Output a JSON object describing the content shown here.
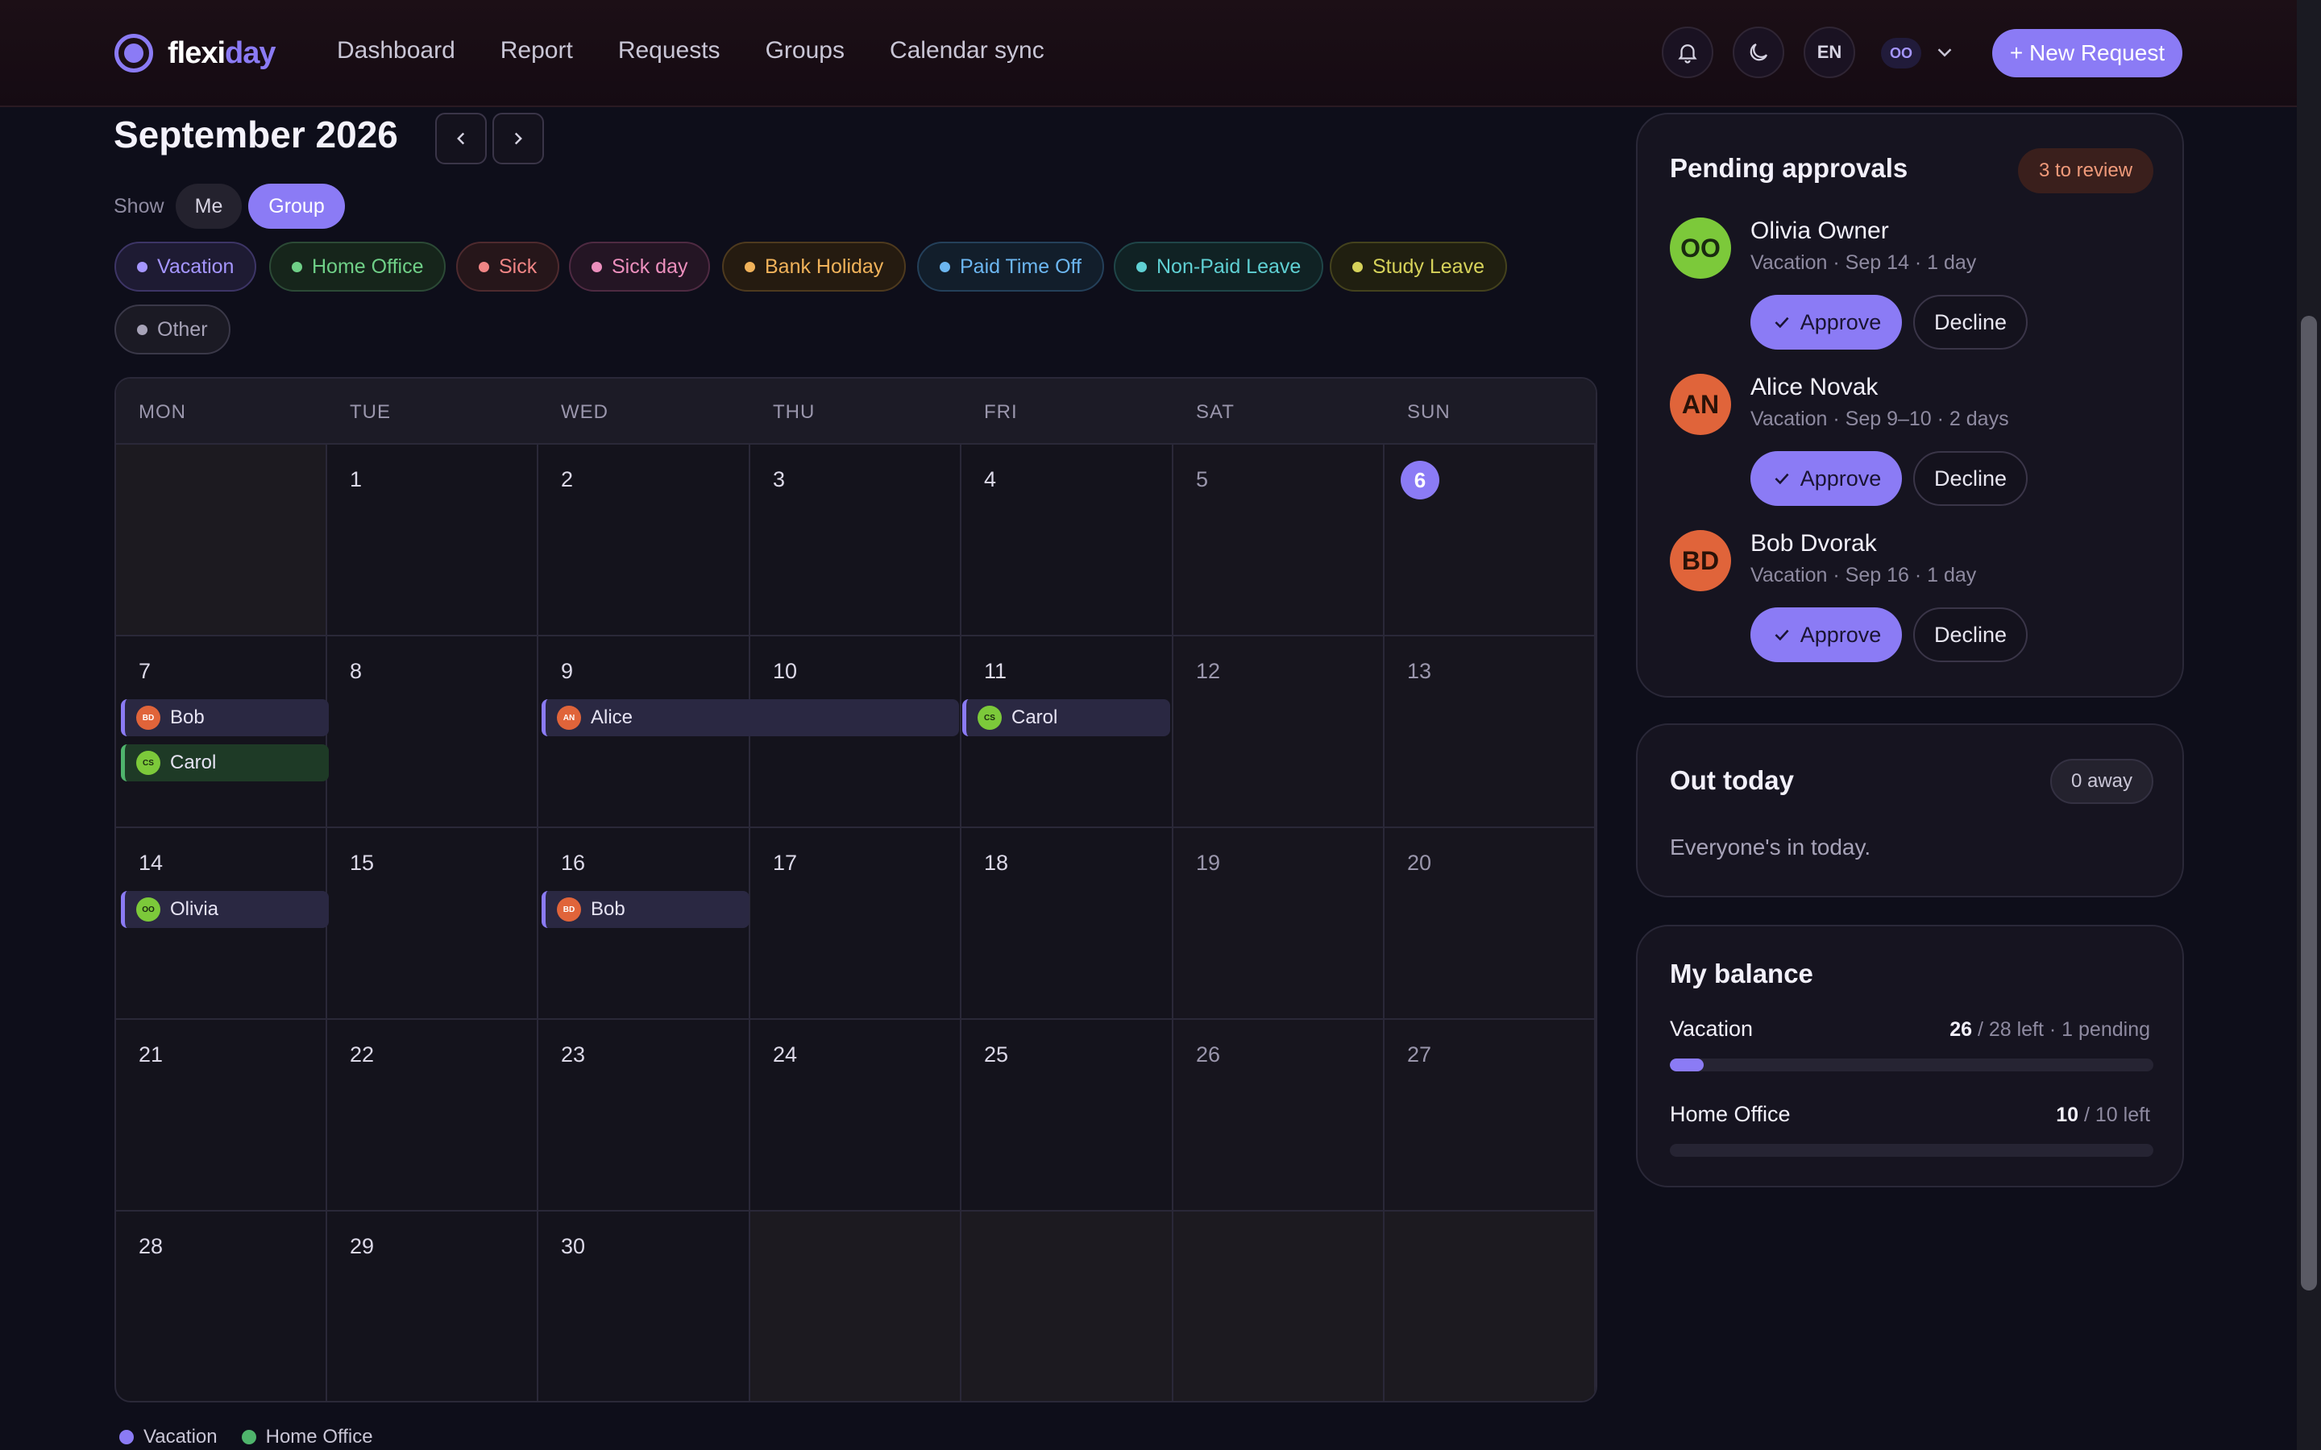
{
  "header": {
    "logo": {
      "part1": "flexi",
      "part2": "day"
    },
    "nav": [
      "Dashboard",
      "Report",
      "Requests",
      "Groups",
      "Calendar sync"
    ],
    "lang": "EN",
    "user_initials": "OO",
    "new_request": "+ New Request"
  },
  "calendar": {
    "title": "September 2026",
    "show_label": "Show",
    "toggle_me": "Me",
    "toggle_group": "Group",
    "filters": [
      {
        "label": "Vacation",
        "color": "#8b7bf5"
      },
      {
        "label": "Home Office",
        "color": "#4fb46c"
      },
      {
        "label": "Sick",
        "color": "#ef6b6b"
      },
      {
        "label": "Sick day",
        "color": "#e06fa8"
      },
      {
        "label": "Bank Holiday",
        "color": "#e9a23b"
      },
      {
        "label": "Paid Time Off",
        "color": "#4ea3e6"
      },
      {
        "label": "Non-Paid Leave",
        "color": "#3cc0c4"
      },
      {
        "label": "Study Leave",
        "color": "#c5c23a"
      },
      {
        "label": "Other",
        "color": "#9a96ac"
      }
    ],
    "weekdays": [
      "MON",
      "TUE",
      "WED",
      "THU",
      "FRI",
      "SAT",
      "SUN"
    ],
    "weeks": [
      [
        "",
        "1",
        "2",
        "3",
        "4",
        "5",
        "6"
      ],
      [
        "7",
        "8",
        "9",
        "10",
        "11",
        "12",
        "13"
      ],
      [
        "14",
        "15",
        "16",
        "17",
        "18",
        "19",
        "20"
      ],
      [
        "21",
        "22",
        "23",
        "24",
        "25",
        "26",
        "27"
      ],
      [
        "28",
        "29",
        "30",
        "",
        "",
        "",
        ""
      ]
    ],
    "today": "6",
    "events": [
      {
        "name": "Bob",
        "initials": "BD",
        "avatar": "#e0643a"
      },
      {
        "name": "Carol",
        "initials": "CS",
        "avatar": "#7cc93a"
      },
      {
        "name": "Alice",
        "initials": "AN",
        "avatar": "#e0643a"
      },
      {
        "name": "Carol",
        "initials": "CS",
        "avatar": "#7cc93a"
      },
      {
        "name": "Olivia",
        "initials": "OO",
        "avatar": "#7cc93a"
      },
      {
        "name": "Bob",
        "initials": "BD",
        "avatar": "#e0643a"
      }
    ],
    "legend": [
      {
        "label": "Vacation",
        "color": "#8b7bf5"
      },
      {
        "label": "Home Office",
        "color": "#4fb46c"
      }
    ]
  },
  "pending": {
    "title": "Pending approvals",
    "badge": "3 to review",
    "approve_label": "Approve",
    "decline_label": "Decline",
    "items": [
      {
        "initials": "OO",
        "name": "Olivia Owner",
        "meta": "Vacation · Sep 14 · 1 day",
        "avatar_bg": "#7cc93a",
        "avatar_fg": "#1a2a10"
      },
      {
        "initials": "AN",
        "name": "Alice Novak",
        "meta": "Vacation · Sep 9–10 · 2 days",
        "avatar_bg": "#e0643a",
        "avatar_fg": "#2a1208"
      },
      {
        "initials": "BD",
        "name": "Bob Dvorak",
        "meta": "Vacation · Sep 16 · 1 day",
        "avatar_bg": "#e0643a",
        "avatar_fg": "#2a1208"
      }
    ]
  },
  "out_today": {
    "title": "Out today",
    "badge": "0 away",
    "message": "Everyone's in today."
  },
  "balance": {
    "title": "My balance",
    "items": [
      {
        "label": "Vacation",
        "value": "26",
        "total": " / 28 left",
        "extra": " · 1 pending",
        "used_fraction": 0.07
      },
      {
        "label": "Home Office",
        "value": "10",
        "total": " / 10 left",
        "extra": "",
        "used_fraction": 0
      }
    ]
  }
}
